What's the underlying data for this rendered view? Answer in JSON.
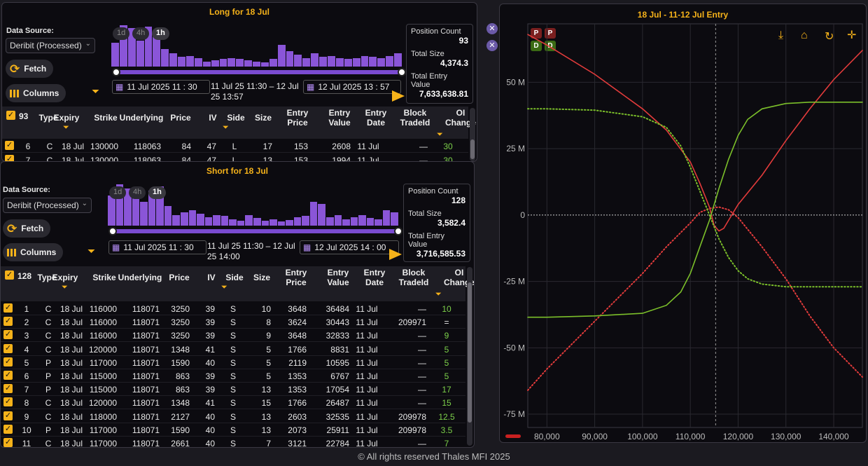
{
  "long": {
    "title": "Long for 18 Jul",
    "data_source_label": "Data Source:",
    "data_source_value": "Deribit (Processed)",
    "fetch_label": "Fetch",
    "columns_label": "Columns",
    "ranges": [
      "1d",
      "4h",
      "1h"
    ],
    "hist": [
      0.55,
      0.95,
      0.88,
      0.6,
      0.92,
      0.75,
      0.4,
      0.3,
      0.22,
      0.25,
      0.2,
      0.12,
      0.15,
      0.18,
      0.2,
      0.17,
      0.15,
      0.12,
      0.1,
      0.18,
      0.5,
      0.35,
      0.28,
      0.2,
      0.3,
      0.22,
      0.25,
      0.2,
      0.18,
      0.2,
      0.25,
      0.22,
      0.2,
      0.25,
      0.3
    ],
    "date_start": "11  Jul  2025  11 : 30",
    "range_text": "11 Jul 25 11:30 – 12 Jul 25 13:57",
    "date_end": "12  Jul  2025  13 : 57",
    "stats": [
      {
        "label": "Position Count",
        "value": "93"
      },
      {
        "label": "Total Size",
        "value": "4,374.3"
      },
      {
        "label": "Total Entry Value",
        "value": "7,633,638.81"
      }
    ],
    "count": "93",
    "rows": [
      [
        "6",
        "C",
        "18 Jul",
        "130000",
        "118063",
        "84",
        "47",
        "L",
        "17",
        "153",
        "2608",
        "11 Jul",
        "—",
        "30"
      ],
      [
        "7",
        "C",
        "18 Jul",
        "130000",
        "118063",
        "84",
        "47",
        "L",
        "13",
        "153",
        "1994",
        "11 Jul",
        "—",
        "30"
      ]
    ]
  },
  "short": {
    "title": "Short for 18 Jul",
    "data_source_label": "Data Source:",
    "data_source_value": "Deribit (Processed)",
    "fetch_label": "Fetch",
    "columns_label": "Columns",
    "ranges": [
      "1d",
      "4h",
      "1h"
    ],
    "hist": [
      0.7,
      0.95,
      0.85,
      0.65,
      0.55,
      0.8,
      0.9,
      0.45,
      0.25,
      0.3,
      0.35,
      0.28,
      0.2,
      0.25,
      0.22,
      0.15,
      0.12,
      0.25,
      0.18,
      0.12,
      0.15,
      0.1,
      0.13,
      0.2,
      0.22,
      0.55,
      0.5,
      0.2,
      0.25,
      0.15,
      0.2,
      0.25,
      0.18,
      0.15,
      0.35,
      0.3
    ],
    "date_start": "11  Jul  2025  11 : 30",
    "range_text": "11 Jul 25 11:30 – 12 Jul 25 14:00",
    "date_end": "12  Jul  2025  14 : 00",
    "stats": [
      {
        "label": "Position Count",
        "value": "128"
      },
      {
        "label": "Total Size",
        "value": "3,582.4"
      },
      {
        "label": "Total Entry Value",
        "value": "3,716,585.53"
      }
    ],
    "count": "128",
    "rows": [
      [
        "1",
        "C",
        "18 Jul",
        "116000",
        "118071",
        "3250",
        "39",
        "S",
        "10",
        "3648",
        "36484",
        "11 Jul",
        "—",
        "10"
      ],
      [
        "2",
        "C",
        "18 Jul",
        "116000",
        "118071",
        "3250",
        "39",
        "S",
        "8",
        "3624",
        "30443",
        "11 Jul",
        "209971",
        "="
      ],
      [
        "3",
        "C",
        "18 Jul",
        "116000",
        "118071",
        "3250",
        "39",
        "S",
        "9",
        "3648",
        "32833",
        "11 Jul",
        "—",
        "9"
      ],
      [
        "4",
        "C",
        "18 Jul",
        "120000",
        "118071",
        "1348",
        "41",
        "S",
        "5",
        "1766",
        "8831",
        "11 Jul",
        "—",
        "5"
      ],
      [
        "5",
        "P",
        "18 Jul",
        "117000",
        "118071",
        "1590",
        "40",
        "S",
        "5",
        "2119",
        "10595",
        "11 Jul",
        "—",
        "5"
      ],
      [
        "6",
        "P",
        "18 Jul",
        "115000",
        "118071",
        "863",
        "39",
        "S",
        "5",
        "1353",
        "6767",
        "11 Jul",
        "—",
        "5"
      ],
      [
        "7",
        "P",
        "18 Jul",
        "115000",
        "118071",
        "863",
        "39",
        "S",
        "13",
        "1353",
        "17054",
        "11 Jul",
        "—",
        "17"
      ],
      [
        "8",
        "C",
        "18 Jul",
        "120000",
        "118071",
        "1348",
        "41",
        "S",
        "15",
        "1766",
        "26487",
        "11 Jul",
        "—",
        "15"
      ],
      [
        "9",
        "C",
        "18 Jul",
        "118000",
        "118071",
        "2127",
        "40",
        "S",
        "13",
        "2603",
        "32535",
        "11 Jul",
        "209978",
        "12.5"
      ],
      [
        "10",
        "P",
        "18 Jul",
        "117000",
        "118071",
        "1590",
        "40",
        "S",
        "13",
        "2073",
        "25911",
        "11 Jul",
        "209978",
        "3.5"
      ],
      [
        "11",
        "C",
        "18 Jul",
        "117000",
        "118071",
        "2661",
        "40",
        "S",
        "7",
        "3121",
        "22784",
        "11 Jul",
        "—",
        "7"
      ]
    ]
  },
  "columns": [
    "Type",
    "Expiry",
    "Strike",
    "Underlying",
    "Price",
    "IV",
    "Side",
    "Size",
    "Entry\nPrice",
    "Entry\nValue",
    "Entry\nDate",
    "Block\nTradeId",
    "OI\nChange"
  ],
  "chart_data": {
    "type": "line",
    "title": "18 Jul - 11-12 Jul Entry",
    "x_ticks": [
      "80,000",
      "90,000",
      "100,000",
      "110,000",
      "120,000",
      "130,000",
      "140,000"
    ],
    "y_ticks": [
      "50 M",
      "25 M",
      "0",
      "-25 M",
      "-50 M",
      "-75 M"
    ],
    "xlim": [
      76000,
      146000
    ],
    "ylim": [
      -80,
      72
    ],
    "spot": 115300,
    "series": [
      {
        "color": "#e23b3b",
        "style": "solid",
        "x": [
          76000,
          80000,
          90000,
          100000,
          105000,
          110000,
          112000,
          114000,
          115000,
          116000,
          117000,
          118000,
          120000,
          125000,
          130000,
          135000,
          140000,
          146000
        ],
        "y": [
          68,
          64,
          53,
          40,
          32,
          20,
          12,
          3,
          -4,
          -6,
          -5,
          -2,
          4,
          15,
          28,
          40,
          51,
          62
        ]
      },
      {
        "color": "#e23b3b",
        "style": "dotted",
        "x": [
          76000,
          80000,
          90000,
          100000,
          105000,
          110000,
          112000,
          114000,
          116000,
          118000,
          120000,
          125000,
          130000,
          135000,
          140000,
          146000
        ],
        "y": [
          -66,
          -58,
          -40,
          -22,
          -12,
          -3,
          1,
          2.5,
          3,
          2,
          -1,
          -12,
          -24,
          -38,
          -50,
          -61
        ]
      },
      {
        "color": "#7bbf2a",
        "style": "solid",
        "x": [
          76000,
          80000,
          90000,
          100000,
          105000,
          108000,
          110000,
          112000,
          114000,
          116000,
          118000,
          120000,
          122000,
          125000,
          130000,
          135000,
          140000,
          146000
        ],
        "y": [
          -38.5,
          -38.5,
          -38,
          -37,
          -34,
          -29,
          -22,
          -12,
          -2,
          10,
          21,
          30,
          36,
          40,
          42,
          42.5,
          42.5,
          42.5
        ]
      },
      {
        "color": "#7bbf2a",
        "style": "dotted",
        "x": [
          76000,
          80000,
          90000,
          100000,
          105000,
          108000,
          110000,
          112000,
          114000,
          116000,
          118000,
          120000,
          122000,
          125000,
          130000,
          135000,
          140000,
          146000
        ],
        "y": [
          40,
          40,
          39.5,
          37,
          33,
          26,
          18,
          9,
          0,
          -9,
          -16,
          -21,
          -24,
          -26,
          -27,
          -27,
          -27,
          -27
        ]
      }
    ]
  },
  "footer": "© All rights reserved Thales MFI 2025"
}
